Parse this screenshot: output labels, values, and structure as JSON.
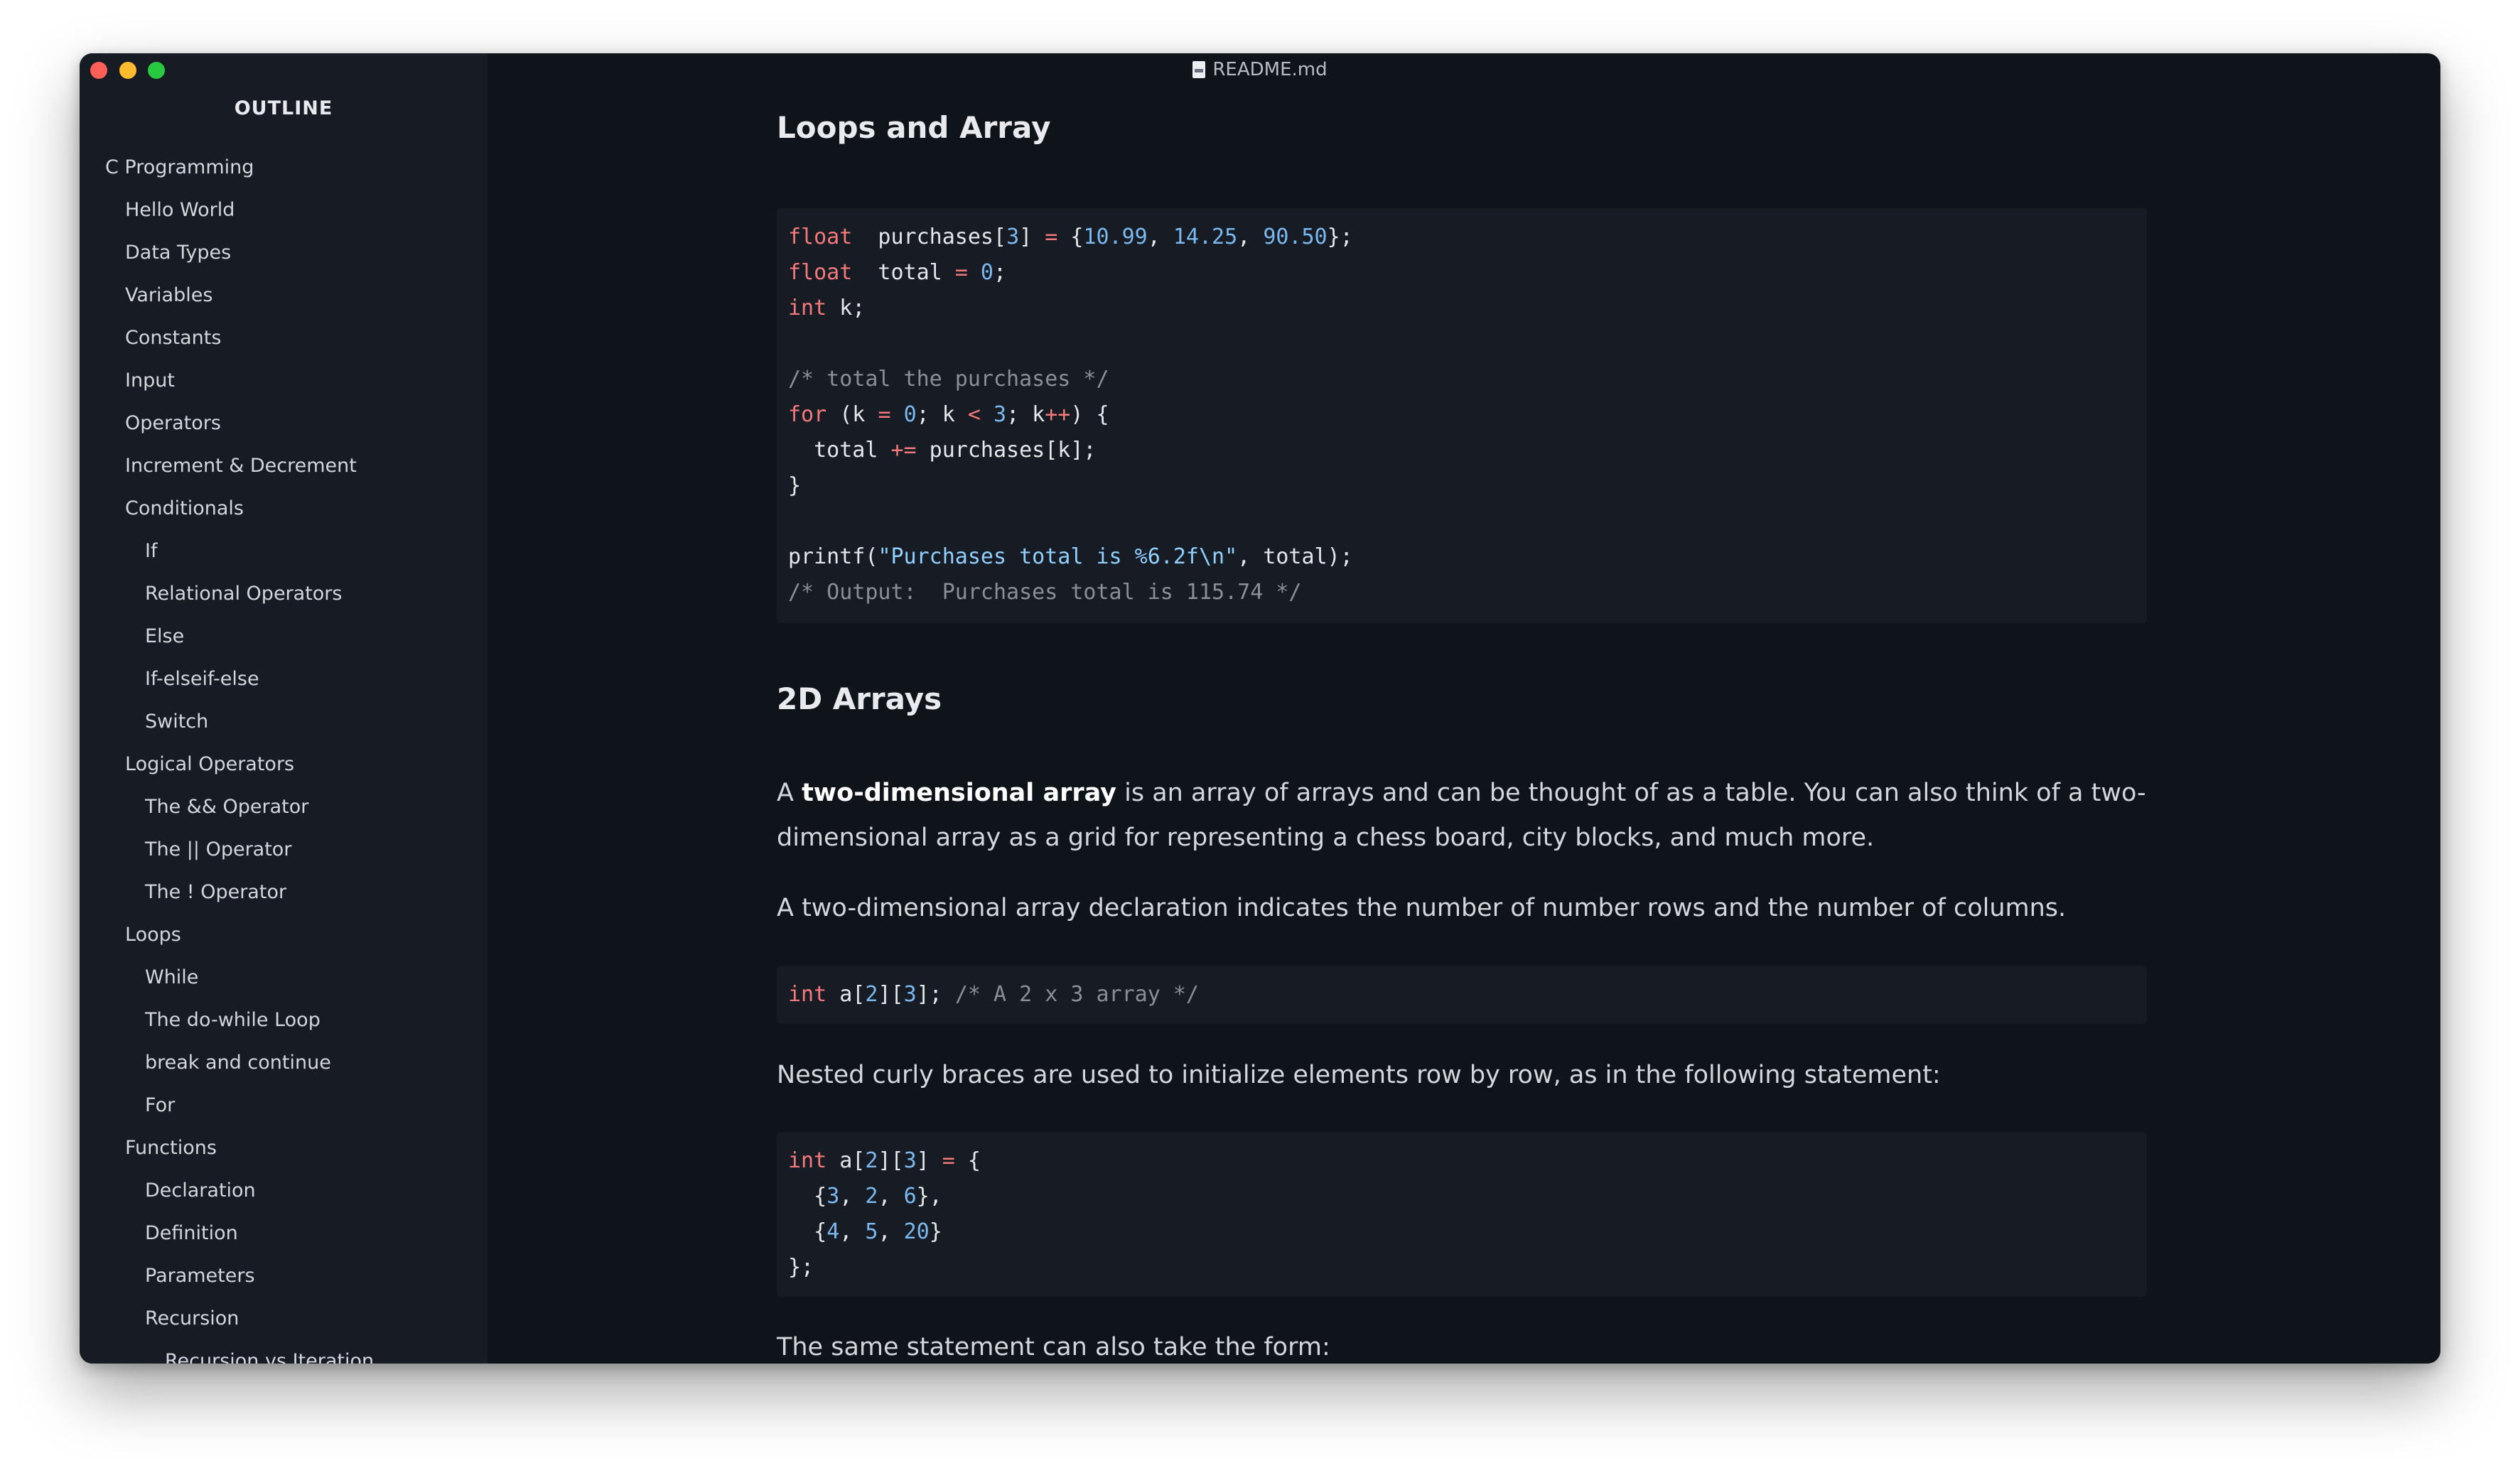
{
  "window": {
    "title": "README.md"
  },
  "sidebar": {
    "heading": "OUTLINE",
    "items": [
      {
        "label": "C Programming",
        "level": 0
      },
      {
        "label": "Hello World",
        "level": 1
      },
      {
        "label": "Data Types",
        "level": 1
      },
      {
        "label": "Variables",
        "level": 1
      },
      {
        "label": "Constants",
        "level": 1
      },
      {
        "label": "Input",
        "level": 1
      },
      {
        "label": "Operators",
        "level": 1
      },
      {
        "label": "Increment & Decrement",
        "level": 1
      },
      {
        "label": "Conditionals",
        "level": 1
      },
      {
        "label": "If",
        "level": 2
      },
      {
        "label": "Relational Operators",
        "level": 2
      },
      {
        "label": "Else",
        "level": 2
      },
      {
        "label": "If-elseif-else",
        "level": 2
      },
      {
        "label": "Switch",
        "level": 2
      },
      {
        "label": "Logical Operators",
        "level": 1
      },
      {
        "label": "The && Operator",
        "level": 2
      },
      {
        "label": "The || Operator",
        "level": 2
      },
      {
        "label": "The ! Operator",
        "level": 2
      },
      {
        "label": "Loops",
        "level": 1
      },
      {
        "label": "While",
        "level": 2
      },
      {
        "label": "The do-while Loop",
        "level": 2
      },
      {
        "label": "break and continue",
        "level": 2
      },
      {
        "label": "For",
        "level": 2
      },
      {
        "label": "Functions",
        "level": 1
      },
      {
        "label": "Declaration",
        "level": 2
      },
      {
        "label": "Definition",
        "level": 2
      },
      {
        "label": "Parameters",
        "level": 2
      },
      {
        "label": "Recursion",
        "level": 2
      },
      {
        "label": "Recursion vs Iteration",
        "level": 3
      }
    ]
  },
  "content": {
    "heading_loops": "Loops and Array",
    "code1": [
      [
        [
          "kw",
          "float"
        ],
        [
          "",
          "  purchases["
        ],
        [
          "num",
          "3"
        ],
        [
          "",
          "] "
        ],
        [
          "op",
          "="
        ],
        [
          "",
          " {"
        ],
        [
          "num",
          "10.99"
        ],
        [
          "",
          ", "
        ],
        [
          "num",
          "14.25"
        ],
        [
          "",
          ", "
        ],
        [
          "num",
          "90.50"
        ],
        [
          "",
          "};"
        ]
      ],
      [
        [
          "kw",
          "float"
        ],
        [
          "",
          "  total "
        ],
        [
          "op",
          "="
        ],
        [
          "",
          ""
        ],
        [
          "num",
          " 0"
        ],
        [
          "",
          ";"
        ]
      ],
      [
        [
          "kw",
          "int"
        ],
        [
          "",
          " k;"
        ]
      ],
      [],
      [
        [
          "cm",
          "/* total the purchases */"
        ]
      ],
      [
        [
          "kw",
          "for"
        ],
        [
          "",
          " (k "
        ],
        [
          "op",
          "="
        ],
        [
          "",
          " "
        ],
        [
          "num",
          "0"
        ],
        [
          "",
          "; k "
        ],
        [
          "op",
          "<"
        ],
        [
          "",
          " "
        ],
        [
          "num",
          "3"
        ],
        [
          "",
          "; k"
        ],
        [
          "op",
          "++"
        ],
        [
          "",
          ") {"
        ]
      ],
      [
        [
          "",
          "  total "
        ],
        [
          "op",
          "+="
        ],
        [
          "",
          " purchases[k];"
        ]
      ],
      [
        [
          "",
          "}"
        ]
      ],
      [],
      [
        [
          "",
          "printf("
        ],
        [
          "str",
          "\"Purchases total is %6.2f\\n\""
        ],
        [
          "",
          ", total);"
        ]
      ],
      [
        [
          "cm",
          "/* Output:  Purchases total is 115.74 */"
        ]
      ]
    ],
    "heading_2d": "2D Arrays",
    "para1_pre": "A ",
    "para1_bold": "two-dimensional array",
    "para1_post": " is an array of arrays and can be thought of as a table. You can also think of a two-dimensional array as a grid for representing a chess board, city blocks, and much more.",
    "para2": "A two-dimensional array declaration indicates the number of number rows and the number of columns.",
    "code2": [
      [
        [
          "kw",
          "int"
        ],
        [
          "",
          " a["
        ],
        [
          "num",
          "2"
        ],
        [
          "",
          "]["
        ],
        [
          "num",
          "3"
        ],
        [
          "",
          "]; "
        ],
        [
          "cm",
          "/* A 2 x 3 array */"
        ]
      ]
    ],
    "para3": "Nested curly braces are used to initialize elements row by row, as in the following statement:",
    "code3": [
      [
        [
          "kw",
          "int"
        ],
        [
          "",
          " a["
        ],
        [
          "num",
          "2"
        ],
        [
          "",
          "]["
        ],
        [
          "num",
          "3"
        ],
        [
          "",
          "] "
        ],
        [
          "op",
          "="
        ],
        [
          "",
          " {"
        ]
      ],
      [
        [
          "",
          "  {"
        ],
        [
          "num",
          "3"
        ],
        [
          "",
          ", "
        ],
        [
          "num",
          "2"
        ],
        [
          "",
          ", "
        ],
        [
          "num",
          "6"
        ],
        [
          "",
          "},"
        ]
      ],
      [
        [
          "",
          "  {"
        ],
        [
          "num",
          "4"
        ],
        [
          "",
          ", "
        ],
        [
          "num",
          "5"
        ],
        [
          "",
          ", "
        ],
        [
          "num",
          "20"
        ],
        [
          "",
          "}"
        ]
      ],
      [
        [
          "",
          "};"
        ]
      ]
    ],
    "para4": "The same statement can also take the form:"
  }
}
